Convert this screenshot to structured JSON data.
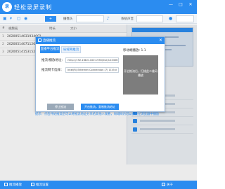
{
  "app": {
    "title": "轻松录屏录制",
    "logo": "录"
  },
  "window_controls": {
    "minimize": "—",
    "maximize": "□",
    "close": "✕"
  },
  "toolbar": {
    "record_btn": "+",
    "duration_label": "时长",
    "size_label": "大小",
    "camera_label": "摄像头",
    "audio_label": "音频",
    "save_label": "系统声音"
  },
  "list": {
    "headers": {
      "num": "#",
      "name": "视频名",
      "duration": "时长",
      "size": "大小"
    },
    "rows": [
      {
        "num": "1",
        "name": "20200514031934001"
      },
      {
        "num": "2",
        "name": "20200514071120001"
      },
      {
        "num": "3",
        "name": "20200514153152001"
      }
    ]
  },
  "modal": {
    "title": "直播推流",
    "close": "✕",
    "tabs": [
      "直播平台推流",
      "局域网推流"
    ],
    "fields": {
      "push_label": "推流/播放地址：",
      "push_value": "rtmp://192.168.0.100:1935/live/123456",
      "network_label": "推流网卡选择：",
      "network_value": "Intel(R) Ethernet Connection (7) I219-V"
    },
    "ip_label": "移动端播放: 1.1",
    "preview_text": "开启推流后，扫描此二维码播放",
    "buttons": {
      "stop": "停止推流",
      "start": "开启推流，复制推流地址"
    }
  },
  "note": "提示：点击开始推流后可以将推流地址分享给其他人观看，局域网内可以直接在浏览器中播放",
  "bottom": {
    "left_item": "推流播放",
    "mid_item": "推流设置",
    "right_item": "关于"
  },
  "colors": {
    "brand": "#2b8cf0"
  }
}
